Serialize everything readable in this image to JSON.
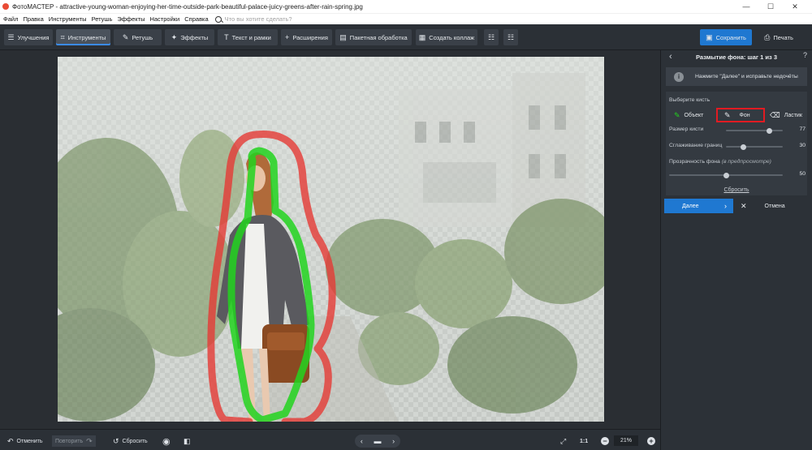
{
  "window": {
    "title": "ФотоМАСТЕР - attractive-young-woman-enjoying-her-time-outside-park-beautiful-palace-juicy-greens-after-rain-spring.jpg",
    "minimize_glyph": "—",
    "maximize_glyph": "☐",
    "close_glyph": "✕"
  },
  "menu": {
    "items": [
      "Файл",
      "Правка",
      "Инструменты",
      "Ретушь",
      "Эффекты",
      "Настройки",
      "Справка"
    ],
    "search_placeholder": "Что вы хотите сделать?"
  },
  "toolbar": {
    "tabs": [
      {
        "label": "Улучшения",
        "icon": "sliders-icon"
      },
      {
        "label": "Инструменты",
        "icon": "crop-icon",
        "active": true
      },
      {
        "label": "Ретушь",
        "icon": "brush-icon"
      },
      {
        "label": "Эффекты",
        "icon": "magic-wand-icon"
      },
      {
        "label": "Текст и рамки",
        "icon": "text-icon"
      },
      {
        "label": "Расширения",
        "icon": "plus-icon"
      }
    ],
    "batch_label": "Пакетная обработка",
    "collage_label": "Создать коллаж",
    "save_label": "Сохранить",
    "print_label": "Печать"
  },
  "panel": {
    "title": "Размытие фона: шаг 1 из 3",
    "hint": "Нажмите \"Далее\" и исправьте недочёты",
    "brush_label": "Выберите кисть",
    "brushes": {
      "object": "Объект",
      "background": "Фон",
      "eraser": "Ластик"
    },
    "selected_brush": "Фон",
    "sliders": {
      "brush_size_label": "Размер кисти",
      "brush_size_value": "77",
      "smoothing_label": "Сглаживание границ",
      "smoothing_value": "30",
      "opacity_label": "Прозрачность фона",
      "opacity_sublabel": "(в предпросмотре)",
      "opacity_value": "50"
    },
    "slider_levels": {
      "brush_size": 0.77,
      "smoothing": 0.3,
      "opacity": 0.5
    },
    "reset_label": "Сбросить",
    "next_label": "Далее",
    "cancel_label": "Отмена"
  },
  "bottom": {
    "undo_label": "Отменить",
    "redo_label": "Повторить",
    "reset_label": "Сбросить",
    "ratio_label": "1:1",
    "zoom_value": "21%"
  },
  "colors": {
    "accent": "#1f78d1",
    "object_stroke": "#22d41e",
    "background_stroke": "#e53935",
    "highlight_border": "#e11b22"
  }
}
